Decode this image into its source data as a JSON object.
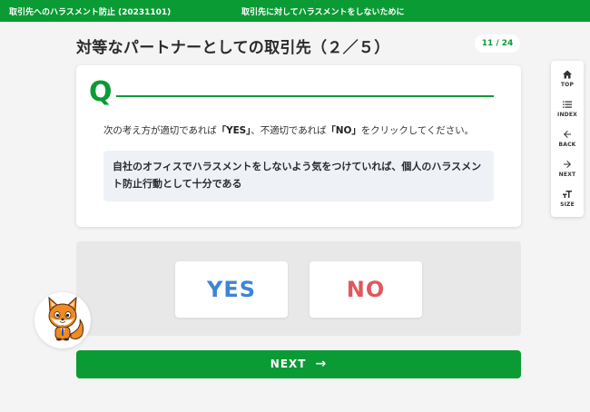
{
  "header": {
    "course_title": "取引先へのハラスメント防止 (20231101)",
    "chapter_title": "取引先に対してハラスメントをしないために"
  },
  "page": {
    "title": "対等なパートナーとしての取引先（２／５）",
    "counter": "11 / 24"
  },
  "question": {
    "letter": "Q",
    "instruction_parts": [
      "次の考え方が適切であれば",
      "「YES」",
      "、不適切であれば",
      "「NO」",
      "をクリックしてください。"
    ],
    "statement": "自社のオフィスでハラスメントをしないよう気をつけていれば、個人のハラスメント防止行動として十分である"
  },
  "answers": {
    "yes_label": "YES",
    "no_label": "NO",
    "yes_color": "#3e84d6",
    "no_color": "#e0585d"
  },
  "next": {
    "label": "NEXT",
    "arrow": "→"
  },
  "sidebar": {
    "items": [
      {
        "label": "TOP",
        "icon": "home-icon"
      },
      {
        "label": "INDEX",
        "icon": "list-icon"
      },
      {
        "label": "BACK",
        "icon": "arrow-left-icon"
      },
      {
        "label": "NEXT",
        "icon": "arrow-right-icon"
      },
      {
        "label": "SIZE",
        "icon": "text-size-icon"
      }
    ]
  },
  "colors": {
    "brand_green": "#0b9b34",
    "background": "#f4f4f4",
    "statement_bg": "#eef2f7"
  },
  "mascot": {
    "icon": "fox-mascot-icon"
  }
}
